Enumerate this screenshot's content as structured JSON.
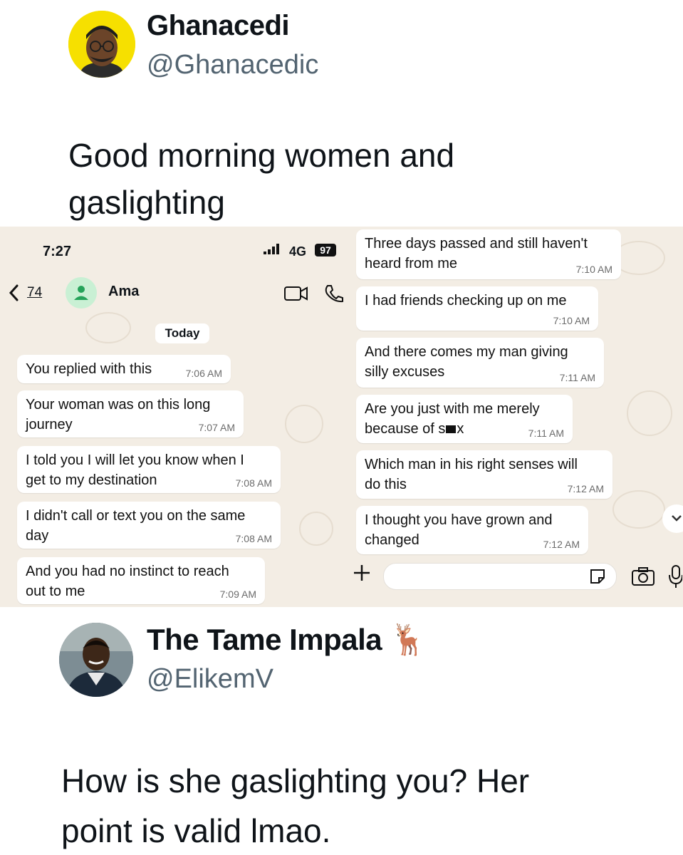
{
  "tweet1": {
    "name": "Ghanacedi",
    "handle": "@Ghanacedic",
    "text_line1": "Good morning women and",
    "text_line2": "gaslighting"
  },
  "chat": {
    "status_time": "7:27",
    "network": "4G",
    "battery": "97",
    "back_count": "74",
    "contact": "Ama",
    "date_chip": "Today",
    "left_messages": [
      {
        "l1": "You replied with this",
        "l2": "",
        "time": "7:06 AM"
      },
      {
        "l1": "Your woman was on this long",
        "l2": "journey",
        "time": "7:07 AM"
      },
      {
        "l1": "I told you I will let you know when I",
        "l2": "get to my destination",
        "time": "7:08 AM"
      },
      {
        "l1": "I didn't call or text you on the same",
        "l2": "day",
        "time": "7:08 AM"
      },
      {
        "l1": "And you had no instinct to reach",
        "l2": "out to me",
        "time": "7:09 AM"
      }
    ],
    "right_messages": [
      {
        "l1": "Three days passed and still haven't",
        "l2": "heard from me",
        "time": "7:10 AM"
      },
      {
        "l1": "I had friends checking up on me",
        "l2": "",
        "time": "7:10 AM"
      },
      {
        "l1": "And there comes my man giving",
        "l2": "silly excuses",
        "time": "7:11 AM"
      },
      {
        "l1": "Are you just with me merely",
        "l2": "because of s",
        "l2_tail": "x",
        "time": "7:11 AM"
      },
      {
        "l1": "Which man in his right senses will",
        "l2": "do this",
        "time": "7:12 AM"
      },
      {
        "l1": "I thought you have grown and",
        "l2": "changed",
        "time": "7:12 AM"
      }
    ],
    "colors": {
      "wallpaper": "#f3ede4",
      "bubble": "#ffffff",
      "avatar_bg": "#c9f0d4",
      "avatar_icon": "#25a35a"
    }
  },
  "tweet2": {
    "name": "The Tame Impala",
    "emoji": "🦌",
    "handle": "@ElikemV",
    "text_line1": "How is she gaslighting you? Her",
    "text_line2": "point is valid lmao."
  }
}
